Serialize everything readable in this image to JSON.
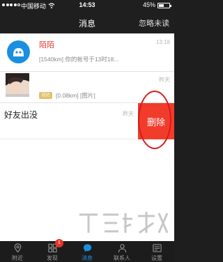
{
  "status_bar": {
    "carrier": "中国移动",
    "time": "14:53",
    "battery_percent": "45%",
    "battery_level": 0.45
  },
  "nav": {
    "title": "消息",
    "ignore_unread": "忽略未读"
  },
  "messages": [
    {
      "name": "陌陌",
      "time": "13:18",
      "preview": "[1540km] 你的帐号于13时18..."
    },
    {
      "time": "昨天",
      "tag": "送达",
      "preview": "[0.08km] [图片]"
    },
    {
      "title": "好友出没",
      "time": "昨天",
      "delete_label": "删除"
    }
  ],
  "tabs": [
    {
      "label": "附近",
      "icon": "location-pin-icon",
      "active": false
    },
    {
      "label": "发现",
      "icon": "grid-icon",
      "badge": "1",
      "active": false
    },
    {
      "label": "消息",
      "icon": "chat-bubble-icon",
      "active": true
    },
    {
      "label": "联系人",
      "icon": "person-icon",
      "active": false
    },
    {
      "label": "设置",
      "icon": "settings-icon",
      "active": false
    }
  ],
  "colors": {
    "accent": "#1a8fe0",
    "delete": "#f23c2b",
    "name_red": "#e0392f",
    "badge": "#e8322b"
  }
}
